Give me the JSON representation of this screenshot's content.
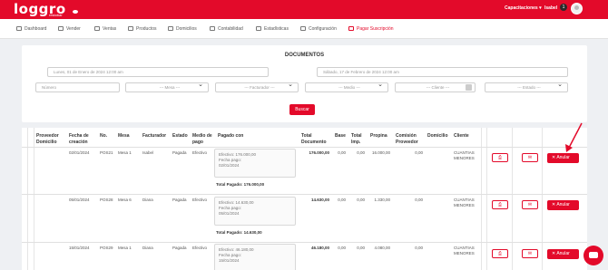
{
  "header": {
    "logo": "loggro",
    "logo_sub": "restobar",
    "menu": "Capacitaciones ▾",
    "user": "Isabel",
    "badge": "1"
  },
  "nav": [
    {
      "label": "Dashboard",
      "icon": "dashboard-icon"
    },
    {
      "label": "Vender",
      "icon": "list-icon"
    },
    {
      "label": "Ventas",
      "icon": "tag-icon"
    },
    {
      "label": "Productos",
      "icon": "box-icon"
    },
    {
      "label": "Domicilios",
      "icon": "bike-icon"
    },
    {
      "label": "Contabilidad",
      "icon": "ledger-icon"
    },
    {
      "label": "Estadísticas",
      "icon": "chart-icon"
    },
    {
      "label": "Configuración",
      "icon": "gear-icon"
    },
    {
      "label": "Pagar Suscripción",
      "icon": "card-icon",
      "active": true
    }
  ],
  "filters": {
    "title": "DOCUMENTOS",
    "date_from": "Lunes, 01 de Enero de 2024 12:00 am",
    "date_to": "Sábado, 17 de Febrero de 2024 12:00 am",
    "numero_placeholder": "Número",
    "mesa": "--- Mesa ---",
    "facturador": "--- Facturador ---",
    "medio": "--- Medio ---",
    "cliente": "--- Cliente ---",
    "estado": "--- Estado ---",
    "search_button": "Buscar"
  },
  "table": {
    "headers": {
      "proveedor": "Proveedor Domicilio",
      "fecha": "Fecha de creación",
      "no": "No.",
      "mesa": "Mesa",
      "facturador": "Facturador",
      "estado": "Estado",
      "medio": "Medio de pago",
      "pagado": "Pagado con",
      "total": "Total Documento",
      "base": "Base",
      "imp": "Total Imp.",
      "propina": "Propina",
      "comision": "Comisión Proveedor",
      "domicilio": "Domicilio",
      "cliente": "Cliente"
    },
    "rows": [
      {
        "fecha": "02/01/2024",
        "no": "POS21",
        "mesa": "Mesa 1",
        "facturador": "Isabel",
        "estado": "Pagada",
        "medio": "Efectivo",
        "pay_line": "Efectivo: 176.000,00",
        "pay_date_label": "Fecha pago:",
        "pay_date": "02/01/2024",
        "pay_total": "Total Pagado: 176.000,00",
        "total": "176.000,00",
        "base": "0,00",
        "imp": "0,00",
        "propina": "16.000,00",
        "comision": "0,00",
        "cliente": "CUANTIAS MENORES",
        "anular": "Anular"
      },
      {
        "fecha": "05/01/2024",
        "no": "POS28",
        "mesa": "Mesa 6",
        "facturador": "Diana",
        "estado": "Pagada",
        "medio": "Efectivo",
        "pay_line": "Efectivo: 14.630,00",
        "pay_date_label": "Fecha pago:",
        "pay_date": "05/01/2024",
        "pay_total": "Total Pagado: 14.630,00",
        "total": "14.630,00",
        "base": "0,00",
        "imp": "0,00",
        "propina": "1.330,00",
        "comision": "0,00",
        "cliente": "CUANTIAS MENORES",
        "anular": "Anular"
      },
      {
        "fecha": "15/01/2024",
        "no": "POS29",
        "mesa": "Mesa 1",
        "facturador": "Diana",
        "estado": "Pagada",
        "medio": "Efectivo",
        "pay_line": "Efectivo: 46.180,00",
        "pay_date_label": "Fecha pago:",
        "pay_date": "15/01/2024",
        "pay_total": "",
        "total": "46.180,00",
        "base": "0,00",
        "imp": "0,00",
        "propina": "4.080,00",
        "comision": "0,00",
        "cliente": "CUANTIAS MENORES",
        "anular": "Anular"
      }
    ]
  },
  "colors": {
    "brand": "#e30a2a"
  }
}
